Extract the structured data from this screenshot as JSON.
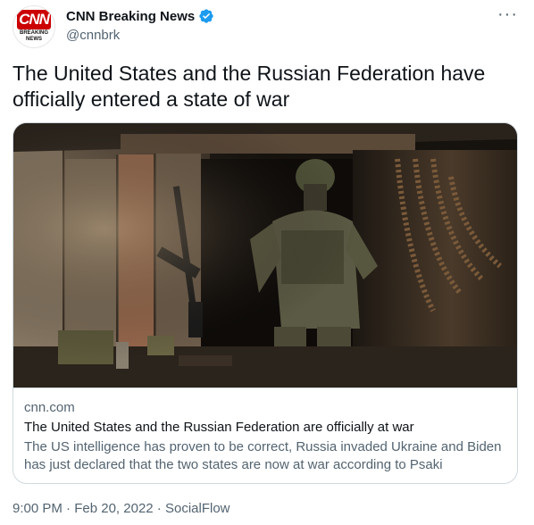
{
  "author": {
    "display_name": "CNN Breaking News",
    "handle": "@cnnbrk",
    "avatar_logo": "CNN",
    "avatar_subtext_1": "BREAKING",
    "avatar_subtext_2": "NEWS",
    "verified_icon": "verified-badge-icon",
    "brand_color": "#cc0000",
    "verified_color": "#1d9bf0"
  },
  "more_icon": "more-options-icon",
  "tweet": {
    "text": "The United States and the Russian Federation have officially entered a state of war"
  },
  "card": {
    "domain": "cnn.com",
    "title": "The United States and the Russian Federation are officially at war",
    "description": "The US intelligence has proven to be correct, Russia invaded Ukraine and Biden has just declared that the two states are now at war according to Psaki"
  },
  "meta": {
    "time": "9:00 PM",
    "separator": "·",
    "date": "Feb 20, 2022",
    "source": "SocialFlow"
  }
}
